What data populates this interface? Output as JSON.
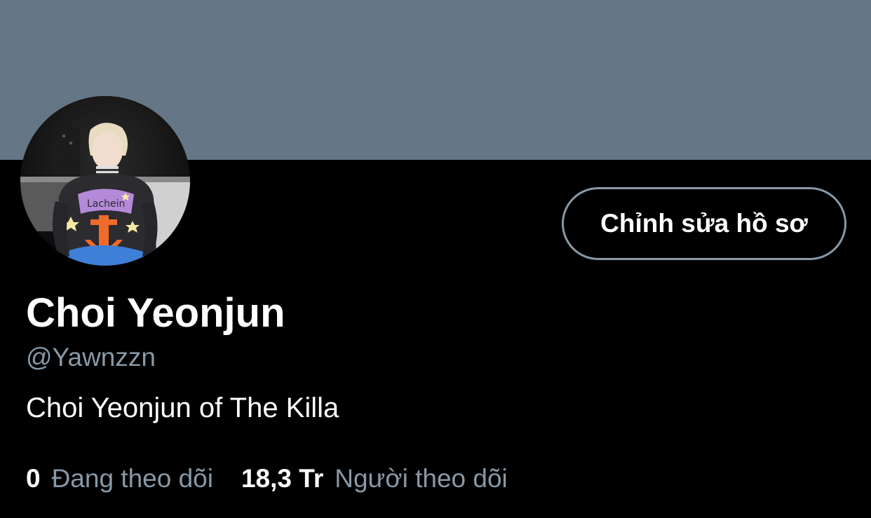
{
  "profile": {
    "display_name": "Choi Yeonjun",
    "handle": "@Yawnzzn",
    "bio": "Choi Yeonjun of The Killa",
    "edit_button_label": "Chỉnh sửa hồ sơ",
    "avatar_icon": "profile-photo"
  },
  "stats": {
    "following": {
      "count": "0",
      "label": "Đang theo dõi"
    },
    "followers": {
      "count": "18,3 Tr",
      "label": "Người theo dõi"
    }
  },
  "colors": {
    "banner": "#657786",
    "background": "#000000",
    "primary_text": "#ffffff",
    "secondary_text": "#8899a6",
    "button_border": "#8899a6"
  }
}
